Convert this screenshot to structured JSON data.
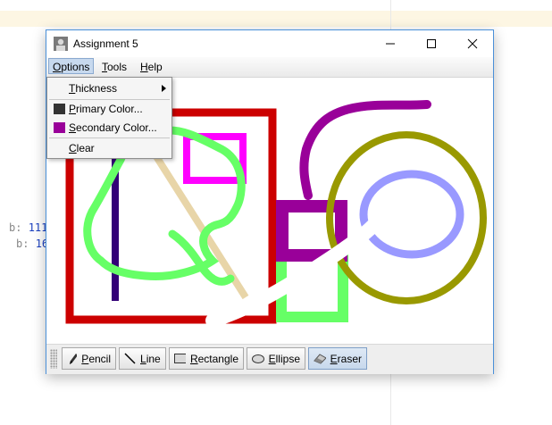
{
  "background": {
    "code_lines": [
      {
        "key": "b:",
        "value": "111"
      },
      {
        "key": "b:",
        "value": "16"
      }
    ]
  },
  "window": {
    "title": "Assignment 5"
  },
  "menubar": {
    "items": [
      {
        "label": "Options",
        "mnemonic": "O",
        "rest": "ptions",
        "active": true
      },
      {
        "label": "Tools",
        "mnemonic": "T",
        "rest": "ools",
        "active": false
      },
      {
        "label": "Help",
        "mnemonic": "H",
        "rest": "elp",
        "active": false
      }
    ]
  },
  "options_menu": {
    "thickness": {
      "mnemonic": "T",
      "rest": "hickness"
    },
    "primary_color": {
      "mnemonic": "P",
      "rest": "rimary Color...",
      "swatch": "#333333"
    },
    "secondary_color": {
      "mnemonic": "S",
      "rest": "econdary Color...",
      "swatch": "#990099"
    },
    "clear": {
      "mnemonic": "C",
      "rest": "lear"
    }
  },
  "toolbar": {
    "tools": [
      {
        "id": "pencil",
        "mnemonic": "P",
        "rest": "encil",
        "icon": "pencil-icon",
        "selected": false
      },
      {
        "id": "line",
        "mnemonic": "L",
        "rest": "ine",
        "icon": "line-icon",
        "selected": false
      },
      {
        "id": "rectangle",
        "mnemonic": "R",
        "rest": "ectangle",
        "icon": "rectangle-icon",
        "selected": false
      },
      {
        "id": "ellipse",
        "mnemonic": "E",
        "rest": "llipse",
        "icon": "ellipse-icon",
        "selected": false
      },
      {
        "id": "eraser",
        "mnemonic": "E",
        "rest": "raser",
        "icon": "eraser-icon",
        "selected": true
      }
    ]
  },
  "colors": {
    "red": "#cc0000",
    "magenta": "#ff00ff",
    "indigo": "#330077",
    "tan": "#e8d5a8",
    "green": "#66ff66",
    "purple": "#990099",
    "olive": "#999900",
    "lavender": "#9999ff"
  }
}
